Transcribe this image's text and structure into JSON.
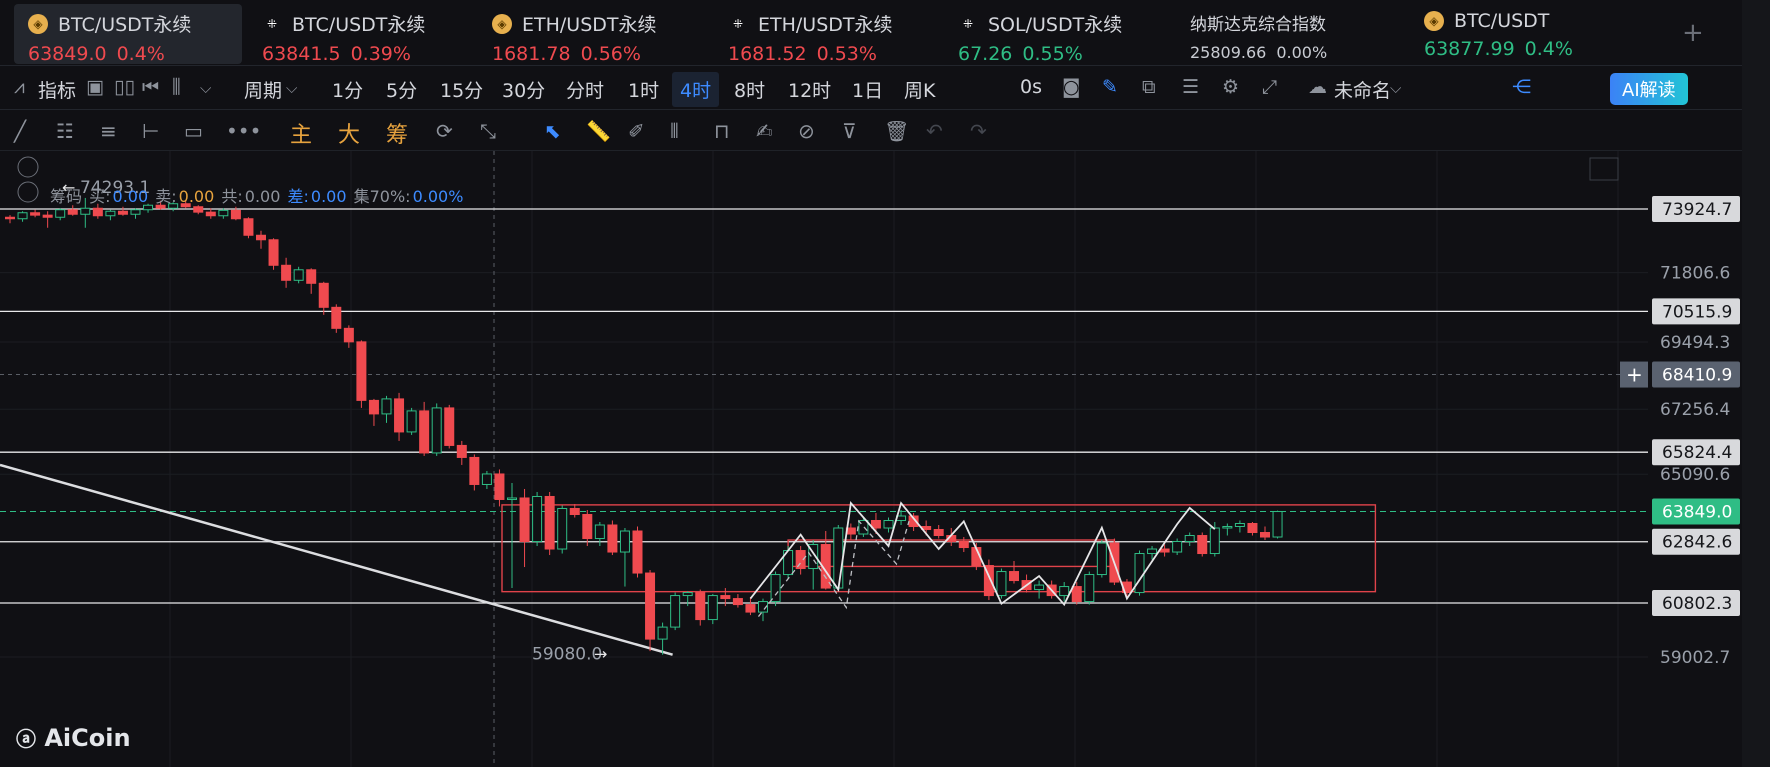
{
  "tabs": [
    {
      "icon": "coin-icon",
      "name": "BTC/USDT永续",
      "price": "63849.0",
      "pct": "0.4%",
      "dir": "dn",
      "active": true
    },
    {
      "icon": "okx-icon",
      "name": "BTC/USDT永续",
      "price": "63841.5",
      "pct": "0.39%",
      "dir": "dn"
    },
    {
      "icon": "coin-icon",
      "name": "ETH/USDT永续",
      "price": "1681.78",
      "pct": "0.56%",
      "dir": "dn"
    },
    {
      "icon": "okx-icon",
      "name": "ETH/USDT永续",
      "price": "1681.52",
      "pct": "0.53%",
      "dir": "dn"
    },
    {
      "icon": "okx-icon",
      "name": "SOL/USDT永续",
      "price": "67.26",
      "pct": "0.55%",
      "dir": "up"
    },
    {
      "icon": "",
      "name": "纳斯达克综合指数",
      "price": "25809.66",
      "pct": "0.00%",
      "dir": "flat"
    },
    {
      "icon": "coin-icon",
      "name": "BTC/USDT",
      "price": "63877.99",
      "pct": "0.4%",
      "dir": "up"
    }
  ],
  "toolbar": {
    "indicator_label": "指标",
    "period_label": "周期",
    "periods": [
      "1分",
      "5分",
      "15分",
      "30分",
      "分时",
      "1时",
      "4时",
      "8时",
      "12时",
      "1日",
      "周K"
    ],
    "selected_period": "4时",
    "timer": "0s",
    "layout_name": "未命名",
    "ai_label": "AI解读"
  },
  "drawbar": {
    "main_label": "主",
    "big_label": "大",
    "chips_label": "筹"
  },
  "indicator": {
    "name": "筹码",
    "buy_label": "买:",
    "buy_value": "0.00",
    "sell_label": "卖:",
    "sell_value": "0.00",
    "total_label": "共:",
    "total_value": "0.00",
    "diff_label": "差:",
    "diff_value": "0.00",
    "conc_label": "集70%:",
    "conc_value": "0.00%"
  },
  "brand": "AiCoin",
  "colors": {
    "up": "#2fbd85",
    "down": "#ef4a4f",
    "accent": "#3d8bff",
    "bg": "#101014"
  },
  "chart_data": {
    "type": "candlestick",
    "interval": "4时",
    "y_axis_ticks": [
      71806.6,
      69494.3,
      67256.4,
      65090.6,
      59002.7
    ],
    "ylim": [
      58200,
      75500
    ],
    "current_price": 63849.0,
    "crosshair_price": 68410.9,
    "high_marker": "74293.1",
    "low_marker": "59080.0",
    "horizontal_levels": [
      73924.7,
      70515.9,
      65824.4,
      62842.6,
      60802.3
    ],
    "level_labels": [
      "73924.7",
      "70515.9",
      "65824.4",
      "62842.6",
      "60802.3"
    ],
    "current_label": "63849.0",
    "crosshair_label": "68410.9",
    "tick_labels": [
      "71806.6",
      "69494.3",
      "67256.4",
      "65090.6",
      "59002.7"
    ],
    "range_box": {
      "from_index": 40,
      "to_index": 108,
      "high": 64070,
      "low": 61180
    },
    "inner_box": {
      "from_index": 62,
      "to_index": 88,
      "high": 62900,
      "low": 62020
    },
    "trendline": {
      "from": [
        0,
        65400
      ],
      "to": [
        52,
        59080
      ]
    },
    "zigzag": [
      [
        59,
        60950
      ],
      [
        63,
        63080
      ],
      [
        66,
        61250
      ],
      [
        67,
        64130
      ],
      [
        70,
        62700
      ],
      [
        71,
        64130
      ],
      [
        74,
        62600
      ],
      [
        76,
        63520
      ],
      [
        79,
        60780
      ],
      [
        82,
        61700
      ],
      [
        84,
        60750
      ],
      [
        87,
        63310
      ],
      [
        89,
        60950
      ],
      [
        93,
        63430
      ],
      [
        94,
        63970
      ],
      [
        96,
        63260
      ]
    ],
    "candles": [
      [
        73650,
        73720,
        73450,
        73600
      ],
      [
        73600,
        73850,
        73500,
        73800
      ],
      [
        73800,
        73900,
        73650,
        73720
      ],
      [
        73720,
        73850,
        73300,
        73650
      ],
      [
        73650,
        73950,
        73550,
        73900
      ],
      [
        73900,
        74050,
        73700,
        73750
      ],
      [
        73750,
        74293,
        73300,
        73950
      ],
      [
        73950,
        74100,
        73600,
        73700
      ],
      [
        73700,
        73900,
        73550,
        73850
      ],
      [
        73850,
        74000,
        73700,
        73750
      ],
      [
        73750,
        73950,
        73600,
        73900
      ],
      [
        73900,
        74100,
        73800,
        74050
      ],
      [
        74050,
        74200,
        73900,
        73950
      ],
      [
        73950,
        74150,
        73850,
        74100
      ],
      [
        74100,
        74200,
        73950,
        74000
      ],
      [
        74000,
        74050,
        73750,
        73820
      ],
      [
        73820,
        73950,
        73600,
        73700
      ],
      [
        73700,
        73950,
        73600,
        73880
      ],
      [
        73880,
        74000,
        73550,
        73600
      ],
      [
        73600,
        73650,
        72950,
        73050
      ],
      [
        73050,
        73200,
        72600,
        72900
      ],
      [
        72900,
        72950,
        71900,
        72050
      ],
      [
        72050,
        72300,
        71300,
        71550
      ],
      [
        71550,
        72000,
        71450,
        71900
      ],
      [
        71900,
        71950,
        71100,
        71450
      ],
      [
        71450,
        71500,
        70400,
        70650
      ],
      [
        70650,
        70750,
        69800,
        69950
      ],
      [
        69950,
        70050,
        69300,
        69500
      ],
      [
        69500,
        69550,
        67300,
        67550
      ],
      [
        67550,
        67600,
        66700,
        67100
      ],
      [
        67100,
        67700,
        66800,
        67600
      ],
      [
        67600,
        67800,
        66200,
        66500
      ],
      [
        66500,
        67300,
        66400,
        67200
      ],
      [
        67200,
        67500,
        65700,
        65800
      ],
      [
        65800,
        67450,
        65700,
        67300
      ],
      [
        67300,
        67400,
        65950,
        66050
      ],
      [
        66050,
        66200,
        65400,
        65650
      ],
      [
        65650,
        65750,
        64550,
        64750
      ],
      [
        64750,
        65200,
        64600,
        65100
      ],
      [
        65100,
        65250,
        64020,
        64250
      ],
      [
        64250,
        64800,
        61300,
        64300
      ],
      [
        64300,
        64600,
        62000,
        62850
      ],
      [
        62850,
        64500,
        62700,
        64350
      ],
      [
        64350,
        64500,
        62400,
        62600
      ],
      [
        62600,
        64050,
        62450,
        63950
      ],
      [
        63950,
        64100,
        63650,
        63750
      ],
      [
        63750,
        63900,
        62700,
        62950
      ],
      [
        62950,
        63500,
        62700,
        63400
      ],
      [
        63400,
        63550,
        62400,
        62500
      ],
      [
        62500,
        63300,
        61350,
        63200
      ],
      [
        63200,
        63350,
        61650,
        61800
      ],
      [
        61800,
        61900,
        59200,
        59600
      ],
      [
        59600,
        60150,
        59080,
        60000
      ],
      [
        60000,
        61150,
        59900,
        61050
      ],
      [
        61050,
        61200,
        60700,
        61150
      ],
      [
        61150,
        61250,
        60050,
        60250
      ],
      [
        60250,
        61100,
        60100,
        61050
      ],
      [
        61050,
        61300,
        60700,
        60950
      ],
      [
        60950,
        61100,
        60650,
        60750
      ],
      [
        60750,
        61000,
        60400,
        60500
      ],
      [
        60500,
        60950,
        60200,
        60850
      ],
      [
        60850,
        61850,
        60700,
        61750
      ],
      [
        61750,
        62700,
        61600,
        62550
      ],
      [
        62550,
        62700,
        61750,
        61950
      ],
      [
        61950,
        62900,
        61250,
        62750
      ],
      [
        62750,
        63200,
        61250,
        61300
      ],
      [
        61300,
        63400,
        61200,
        63300
      ],
      [
        63300,
        63450,
        62900,
        63100
      ],
      [
        63100,
        63650,
        63000,
        63550
      ],
      [
        63550,
        63800,
        63100,
        63300
      ],
      [
        63300,
        63650,
        63150,
        63550
      ],
      [
        63550,
        63900,
        63400,
        63700
      ],
      [
        63700,
        63800,
        63200,
        63350
      ],
      [
        63350,
        63550,
        63050,
        63250
      ],
      [
        63250,
        63400,
        62950,
        63050
      ],
      [
        63050,
        63300,
        62700,
        62850
      ],
      [
        62850,
        63000,
        62500,
        62650
      ],
      [
        62650,
        62800,
        61900,
        62050
      ],
      [
        62050,
        62250,
        60900,
        61050
      ],
      [
        61050,
        61950,
        60950,
        61850
      ],
      [
        61850,
        62200,
        61450,
        61550
      ],
      [
        61550,
        61750,
        61150,
        61250
      ],
      [
        61250,
        61550,
        60950,
        61400
      ],
      [
        61400,
        61550,
        60950,
        61050
      ],
      [
        61050,
        61500,
        60850,
        61350
      ],
      [
        61350,
        61500,
        60750,
        60850
      ],
      [
        60850,
        61850,
        60750,
        61750
      ],
      [
        61750,
        62900,
        61650,
        62800
      ],
      [
        62800,
        62950,
        61400,
        61500
      ],
      [
        61500,
        61600,
        60950,
        61150
      ],
      [
        61150,
        62550,
        61050,
        62450
      ],
      [
        62450,
        62700,
        62250,
        62600
      ],
      [
        62600,
        62750,
        62350,
        62500
      ],
      [
        62500,
        62950,
        62400,
        62850
      ],
      [
        62850,
        63150,
        62700,
        63050
      ],
      [
        63050,
        63150,
        62350,
        62450
      ],
      [
        62450,
        63500,
        62350,
        63300
      ],
      [
        63300,
        63450,
        63050,
        63350
      ],
      [
        63350,
        63550,
        63150,
        63450
      ],
      [
        63450,
        63500,
        63050,
        63150
      ],
      [
        63150,
        63350,
        62900,
        63000
      ],
      [
        63000,
        63880,
        62950,
        63849
      ]
    ]
  }
}
